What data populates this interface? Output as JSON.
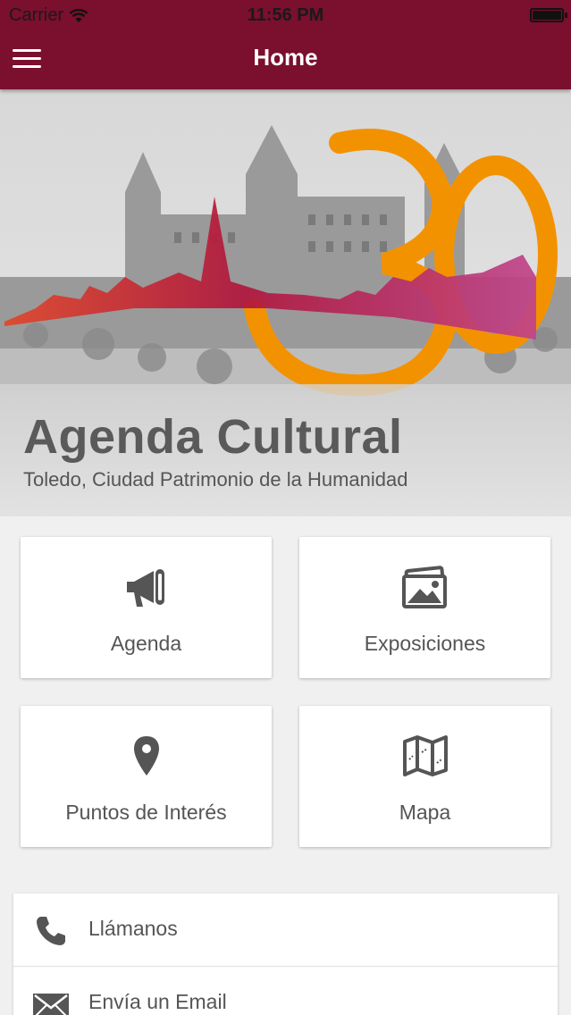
{
  "status_bar": {
    "carrier": "Carrier",
    "time": "11:56 PM",
    "icons": [
      "wifi-icon",
      "battery-icon"
    ]
  },
  "navbar": {
    "title": "Home",
    "menu_icon": "hamburger-menu-icon"
  },
  "hero": {
    "title": "Agenda Cultural",
    "subtitle": "Toledo, Ciudad Patrimonio de la Humanidad",
    "logo_colors": {
      "orange": "#f39200",
      "crimson": "#b0163d",
      "magenta": "#c0448a"
    }
  },
  "grid": [
    {
      "label": "Agenda",
      "icon": "megaphone-icon"
    },
    {
      "label": "Exposiciones",
      "icon": "gallery-icon"
    },
    {
      "label": "Puntos de Interés",
      "icon": "map-pin-icon"
    },
    {
      "label": "Mapa",
      "icon": "folded-map-icon"
    }
  ],
  "contact": [
    {
      "label": "Llámanos",
      "icon": "phone-icon"
    },
    {
      "label": "Envía un Email",
      "icon": "envelope-icon"
    }
  ],
  "colors": {
    "header": "#7a0f2e",
    "background": "#f0f0f0",
    "icon": "#555555"
  }
}
